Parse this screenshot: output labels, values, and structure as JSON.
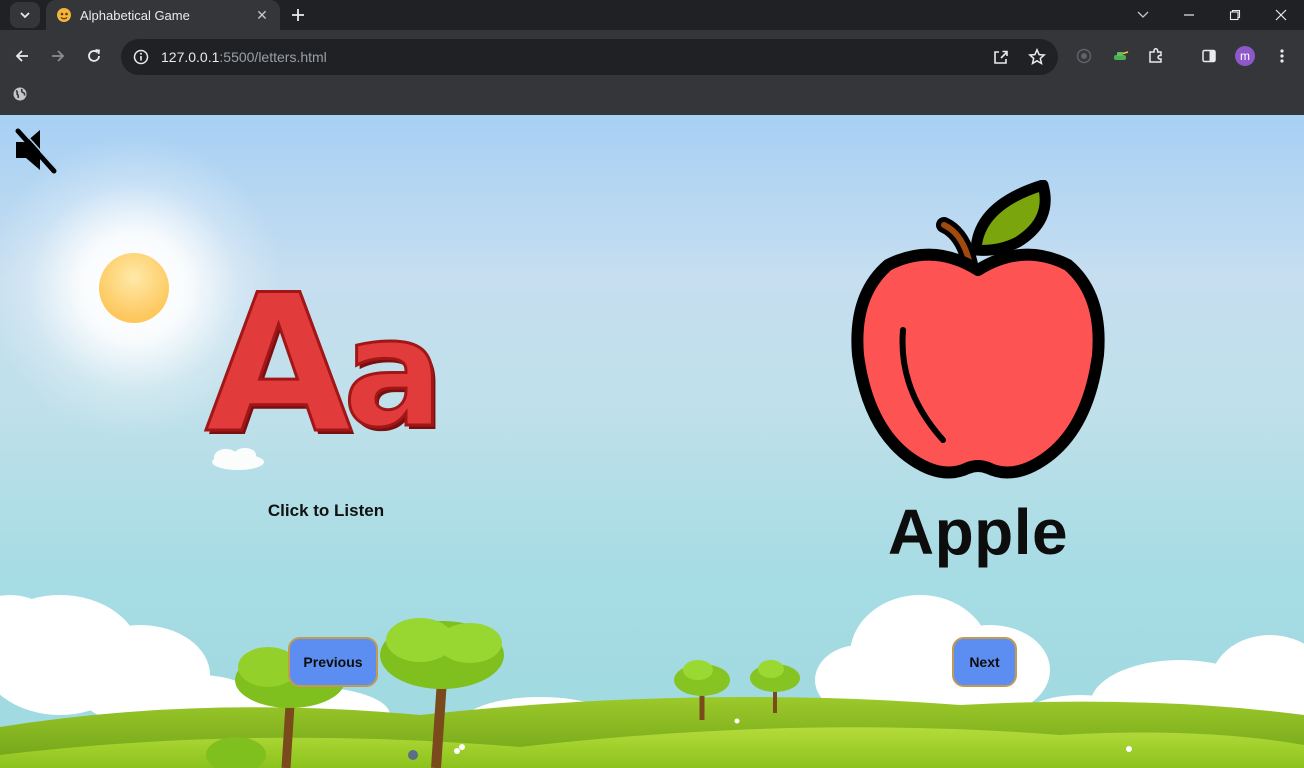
{
  "browser": {
    "tab_title": "Alphabetical Game",
    "url_host": "127.0.0.1",
    "url_path": ":5500/letters.html",
    "profile_initial": "m"
  },
  "game": {
    "letter_upper": "A",
    "letter_lower": "a",
    "letter_display": "Aa",
    "listen_label": "Click to Listen",
    "word": "Apple",
    "previous_label": "Previous",
    "next_label": "Next",
    "sound_muted": true
  },
  "colors": {
    "letter_red": "#e23b3b",
    "apple_red": "#fd5353",
    "leaf_green": "#7ba50d",
    "button_blue": "#5b8ef0",
    "button_border": "#c29a52"
  },
  "icons": {
    "mute": "speaker-muted-icon",
    "sun": "sun-decoration",
    "apple": "apple-image"
  }
}
